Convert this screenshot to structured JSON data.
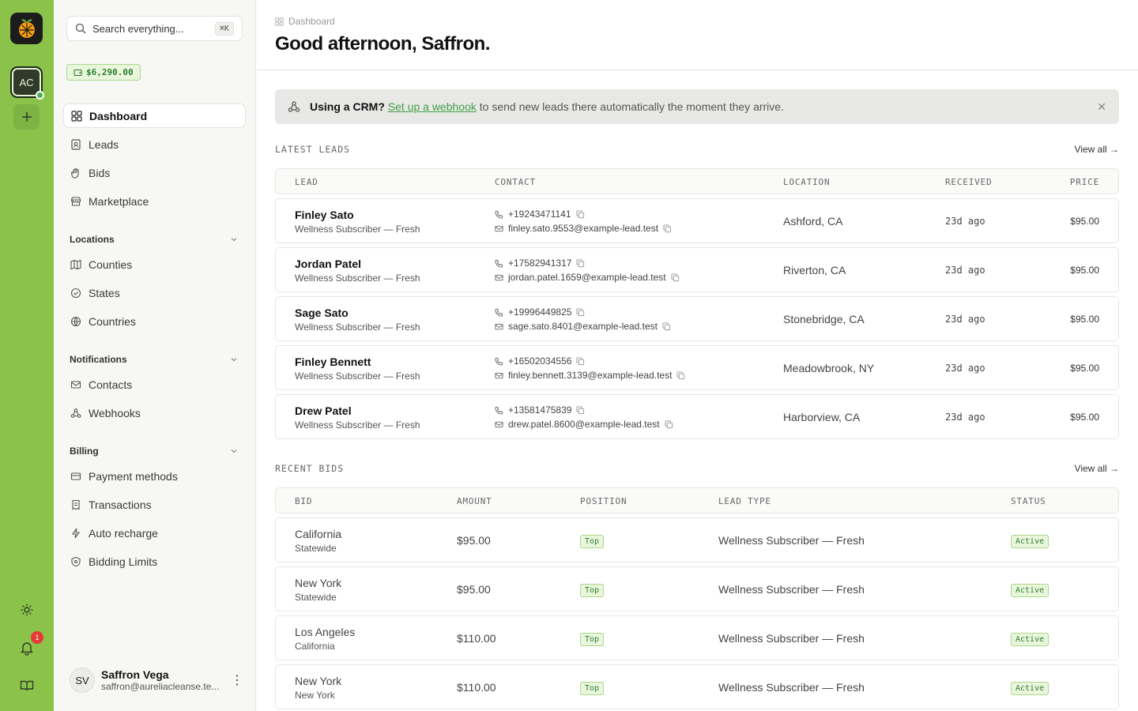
{
  "rail": {
    "workspace_initials": "AC",
    "notification_count": "1"
  },
  "sidebar": {
    "search_placeholder": "Search everything...",
    "search_shortcut": "⌘K",
    "balance": "$6,290.00",
    "main_items": [
      {
        "label": "Dashboard",
        "icon": "grid-icon"
      },
      {
        "label": "Leads",
        "icon": "contact-icon"
      },
      {
        "label": "Bids",
        "icon": "hand-icon"
      },
      {
        "label": "Marketplace",
        "icon": "store-icon"
      }
    ],
    "locations": {
      "title": "Locations",
      "items": [
        {
          "label": "Counties",
          "icon": "map-icon"
        },
        {
          "label": "States",
          "icon": "badge-icon"
        },
        {
          "label": "Countries",
          "icon": "globe-icon"
        }
      ]
    },
    "notifications": {
      "title": "Notifications",
      "items": [
        {
          "label": "Contacts",
          "icon": "mail-icon"
        },
        {
          "label": "Webhooks",
          "icon": "webhook-icon"
        }
      ]
    },
    "billing": {
      "title": "Billing",
      "items": [
        {
          "label": "Payment methods",
          "icon": "card-icon"
        },
        {
          "label": "Transactions",
          "icon": "receipt-icon"
        },
        {
          "label": "Auto recharge",
          "icon": "bolt-icon"
        },
        {
          "label": "Bidding Limits",
          "icon": "shield-icon"
        }
      ]
    },
    "user": {
      "initials": "SV",
      "name": "Saffron Vega",
      "email": "saffron@aureliacleanse.te..."
    }
  },
  "header": {
    "breadcrumb": "Dashboard",
    "title": "Good afternoon, Saffron."
  },
  "banner": {
    "bold": "Using a CRM?",
    "link": "Set up a webhook",
    "rest": "to send new leads there automatically the moment they arrive."
  },
  "leads": {
    "title": "LATEST LEADS",
    "view_all": "View all →",
    "columns": [
      "LEAD",
      "CONTACT",
      "LOCATION",
      "RECEIVED",
      "PRICE"
    ],
    "rows": [
      {
        "name": "Finley Sato",
        "type": "Wellness Subscriber — Fresh",
        "phone": "+19243471141",
        "email": "finley.sato.9553@example-lead.test",
        "location": "Ashford, CA",
        "received": "23d ago",
        "price": "$95.00"
      },
      {
        "name": "Jordan Patel",
        "type": "Wellness Subscriber — Fresh",
        "phone": "+17582941317",
        "email": "jordan.patel.1659@example-lead.test",
        "location": "Riverton, CA",
        "received": "23d ago",
        "price": "$95.00"
      },
      {
        "name": "Sage Sato",
        "type": "Wellness Subscriber — Fresh",
        "phone": "+19996449825",
        "email": "sage.sato.8401@example-lead.test",
        "location": "Stonebridge, CA",
        "received": "23d ago",
        "price": "$95.00"
      },
      {
        "name": "Finley Bennett",
        "type": "Wellness Subscriber — Fresh",
        "phone": "+16502034556",
        "email": "finley.bennett.3139@example-lead.test",
        "location": "Meadowbrook, NY",
        "received": "23d ago",
        "price": "$95.00"
      },
      {
        "name": "Drew Patel",
        "type": "Wellness Subscriber — Fresh",
        "phone": "+13581475839",
        "email": "drew.patel.8600@example-lead.test",
        "location": "Harborview, CA",
        "received": "23d ago",
        "price": "$95.00"
      }
    ]
  },
  "bids": {
    "title": "RECENT BIDS",
    "view_all": "View all →",
    "columns": [
      "BID",
      "AMOUNT",
      "POSITION",
      "LEAD TYPE",
      "STATUS"
    ],
    "rows": [
      {
        "name": "California",
        "scope": "Statewide",
        "amount": "$95.00",
        "position": "Top",
        "lead_type": "Wellness Subscriber — Fresh",
        "status": "Active"
      },
      {
        "name": "New York",
        "scope": "Statewide",
        "amount": "$95.00",
        "position": "Top",
        "lead_type": "Wellness Subscriber — Fresh",
        "status": "Active"
      },
      {
        "name": "Los Angeles",
        "scope": "California",
        "amount": "$110.00",
        "position": "Top",
        "lead_type": "Wellness Subscriber — Fresh",
        "status": "Active"
      },
      {
        "name": "New York",
        "scope": "New York",
        "amount": "$110.00",
        "position": "Top",
        "lead_type": "Wellness Subscriber — Fresh",
        "status": "Active"
      }
    ]
  }
}
